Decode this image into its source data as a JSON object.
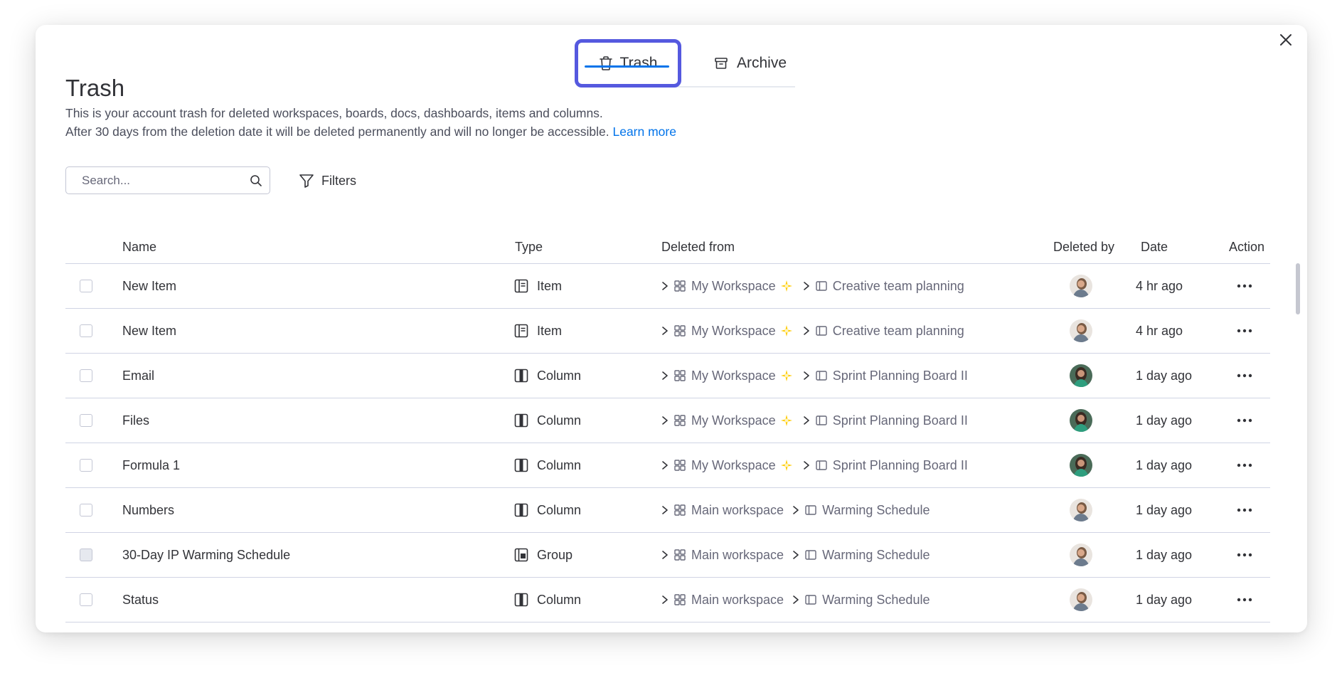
{
  "tabs": [
    {
      "label": "Trash",
      "icon": "trash-icon",
      "active": true
    },
    {
      "label": "Archive",
      "icon": "archive-icon",
      "active": false
    }
  ],
  "page": {
    "title": "Trash",
    "description_line1": "This is your account trash for deleted workspaces, boards, docs, dashboards, items and columns.",
    "description_line2": "After 30 days from the deletion date it will be deleted permanently and will no longer be accessible.",
    "learn_more": "Learn more"
  },
  "search": {
    "placeholder": "Search..."
  },
  "filters": {
    "label": "Filters"
  },
  "columns": {
    "name": "Name",
    "type": "Type",
    "deleted_from": "Deleted from",
    "deleted_by": "Deleted by",
    "date": "Date",
    "action": "Action"
  },
  "rows": [
    {
      "name": "New Item",
      "type": "Item",
      "type_icon": "item-icon",
      "workspace": "My Workspace",
      "workspace_sparkle": true,
      "board": "Creative team planning",
      "avatar": "avatar-a",
      "date": "4 hr ago",
      "checkbox_state": "empty"
    },
    {
      "name": "New Item",
      "type": "Item",
      "type_icon": "item-icon",
      "workspace": "My Workspace",
      "workspace_sparkle": true,
      "board": "Creative team planning",
      "avatar": "avatar-a",
      "date": "4 hr ago",
      "checkbox_state": "empty"
    },
    {
      "name": "Email",
      "type": "Column",
      "type_icon": "column-icon",
      "workspace": "My Workspace",
      "workspace_sparkle": true,
      "board": "Sprint Planning Board II",
      "avatar": "avatar-b",
      "date": "1 day ago",
      "checkbox_state": "empty"
    },
    {
      "name": "Files",
      "type": "Column",
      "type_icon": "column-icon",
      "workspace": "My Workspace",
      "workspace_sparkle": true,
      "board": "Sprint Planning Board II",
      "avatar": "avatar-b",
      "date": "1 day ago",
      "checkbox_state": "empty"
    },
    {
      "name": "Formula 1",
      "type": "Column",
      "type_icon": "column-icon",
      "workspace": "My Workspace",
      "workspace_sparkle": true,
      "board": "Sprint Planning Board II",
      "avatar": "avatar-b",
      "date": "1 day ago",
      "checkbox_state": "empty"
    },
    {
      "name": "Numbers",
      "type": "Column",
      "type_icon": "column-icon",
      "workspace": "Main workspace",
      "workspace_sparkle": false,
      "board": "Warming Schedule",
      "avatar": "avatar-a",
      "date": "1 day ago",
      "checkbox_state": "empty"
    },
    {
      "name": "30-Day IP Warming Schedule",
      "type": "Group",
      "type_icon": "group-icon",
      "workspace": "Main workspace",
      "workspace_sparkle": false,
      "board": "Warming Schedule",
      "avatar": "avatar-a",
      "date": "1 day ago",
      "checkbox_state": "hover"
    },
    {
      "name": "Status",
      "type": "Column",
      "type_icon": "column-icon",
      "workspace": "Main workspace",
      "workspace_sparkle": false,
      "board": "Warming Schedule",
      "avatar": "avatar-a",
      "date": "1 day ago",
      "checkbox_state": "empty"
    }
  ],
  "colors": {
    "accent": "#0073ea",
    "highlight_border": "#5559df",
    "text": "#323338",
    "muted": "#676879",
    "divider": "#d0d4e4"
  }
}
